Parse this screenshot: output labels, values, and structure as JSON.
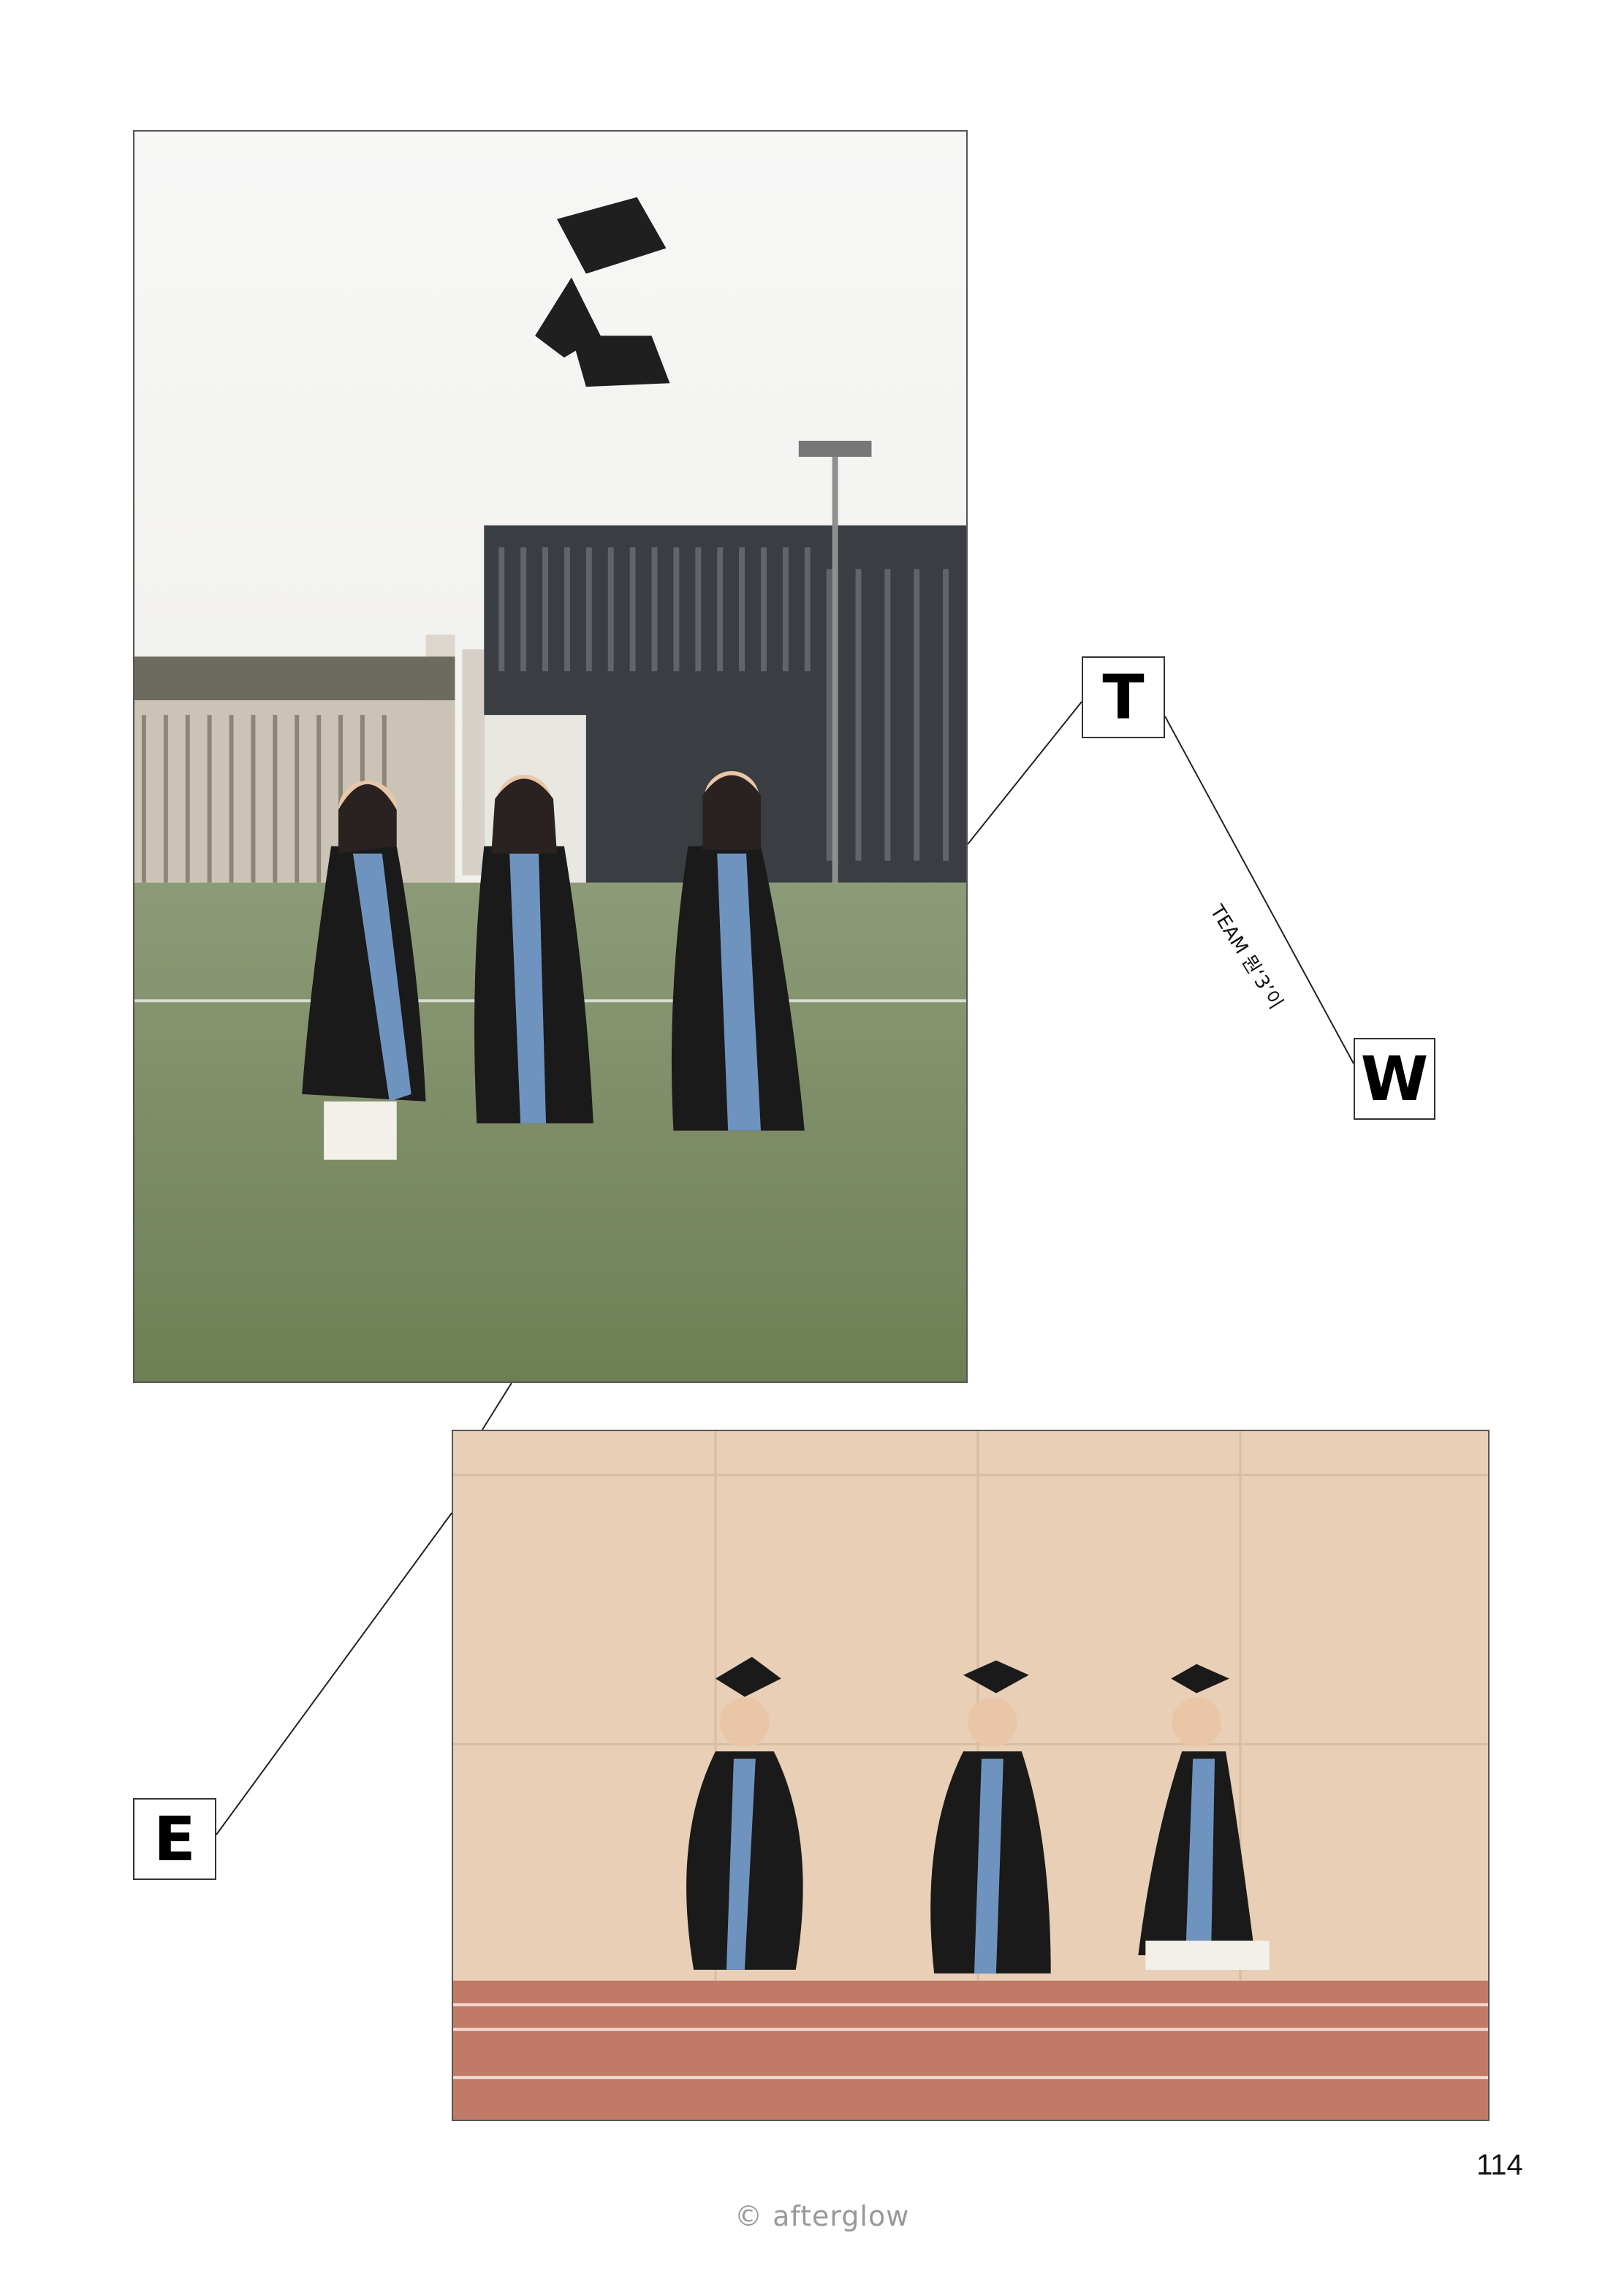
{
  "callouts": {
    "t": "T",
    "w": "W",
    "e": "E"
  },
  "team_label": "TEAM 뭔‘3’이",
  "page_number": "114",
  "footer": "© afterglow",
  "photos": {
    "top": {
      "subject": "three-graduates-throwing-caps"
    },
    "bottom": {
      "subject": "three-graduates-walking-on-track"
    }
  },
  "colors": {
    "gown": "#1a1a1a",
    "stole": "#6f93bf",
    "grass": "#7b8c63",
    "wall": "#e8cfb5",
    "track": "#c27a68"
  }
}
